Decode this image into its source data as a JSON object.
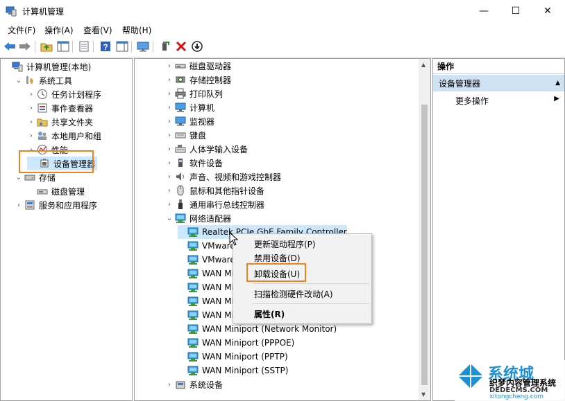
{
  "window": {
    "title": "计算机管理",
    "minimize": "—",
    "maximize": "☐",
    "close": "✕"
  },
  "menu": [
    "文件(F)",
    "操作(A)",
    "查看(V)",
    "帮助(H)"
  ],
  "toolbar": {
    "buttons": [
      "back-icon",
      "forward-icon",
      "up-folder-icon",
      "show-tree-icon",
      "properties-icon",
      "help-icon",
      "show-action-pane-icon",
      "monitor-icon",
      "enable-device-icon",
      "uninstall-icon",
      "download-driver-icon"
    ]
  },
  "left_tree": [
    {
      "label": "计算机管理(本地)",
      "indent": 0,
      "chev": "",
      "icon": "computer-mgmt-icon"
    },
    {
      "label": "系统工具",
      "indent": 1,
      "chev": "⌄",
      "icon": "tools-icon"
    },
    {
      "label": "任务计划程序",
      "indent": 2,
      "chev": "›",
      "icon": "clock-icon"
    },
    {
      "label": "事件查看器",
      "indent": 2,
      "chev": "›",
      "icon": "event-viewer-icon"
    },
    {
      "label": "共享文件夹",
      "indent": 2,
      "chev": "›",
      "icon": "shared-folder-icon"
    },
    {
      "label": "本地用户和组",
      "indent": 2,
      "chev": "›",
      "icon": "users-icon"
    },
    {
      "label": "性能",
      "indent": 2,
      "chev": "›",
      "icon": "performance-icon"
    },
    {
      "label": "设备管理器",
      "indent": 2,
      "chev": "",
      "icon": "device-manager-icon"
    },
    {
      "label": "存储",
      "indent": 1,
      "chev": "⌄",
      "icon": "storage-icon"
    },
    {
      "label": "磁盘管理",
      "indent": 2,
      "chev": "",
      "icon": "disk-icon"
    },
    {
      "label": "服务和应用程序",
      "indent": 1,
      "chev": "›",
      "icon": "services-icon"
    }
  ],
  "device_tree": [
    {
      "label": "磁盘驱动器",
      "indent": 1,
      "chev": "›",
      "icon": "disk-drive-icon"
    },
    {
      "label": "存储控制器",
      "indent": 1,
      "chev": "›",
      "icon": "storage-controller-icon"
    },
    {
      "label": "打印队列",
      "indent": 1,
      "chev": "›",
      "icon": "printer-icon"
    },
    {
      "label": "计算机",
      "indent": 1,
      "chev": "›",
      "icon": "monitor-icon"
    },
    {
      "label": "监视器",
      "indent": 1,
      "chev": "›",
      "icon": "monitor-icon"
    },
    {
      "label": "键盘",
      "indent": 1,
      "chev": "›",
      "icon": "keyboard-icon"
    },
    {
      "label": "人体学输入设备",
      "indent": 1,
      "chev": "›",
      "icon": "hid-icon"
    },
    {
      "label": "软件设备",
      "indent": 1,
      "chev": "›",
      "icon": "software-device-icon"
    },
    {
      "label": "声音、视频和游戏控制器",
      "indent": 1,
      "chev": "›",
      "icon": "speaker-icon"
    },
    {
      "label": "鼠标和其他指针设备",
      "indent": 1,
      "chev": "›",
      "icon": "mouse-icon"
    },
    {
      "label": "通用串行总线控制器",
      "indent": 1,
      "chev": "›",
      "icon": "usb-icon"
    },
    {
      "label": "网络适配器",
      "indent": 1,
      "chev": "⌄",
      "icon": "network-adapter-icon"
    },
    {
      "label": "Realtek PCIe GbE Family Controller",
      "indent": 2,
      "chev": "",
      "icon": "network-adapter-icon"
    },
    {
      "label": "VMware",
      "indent": 2,
      "chev": "",
      "icon": "network-adapter-icon"
    },
    {
      "label": "VMware",
      "indent": 2,
      "chev": "",
      "icon": "network-adapter-icon"
    },
    {
      "label": "WAN Mini",
      "indent": 2,
      "chev": "",
      "icon": "network-adapter-icon"
    },
    {
      "label": "WAN Mini",
      "indent": 2,
      "chev": "",
      "icon": "network-adapter-icon"
    },
    {
      "label": "WAN Mini",
      "indent": 2,
      "chev": "",
      "icon": "network-adapter-icon"
    },
    {
      "label": "WAN Mini",
      "indent": 2,
      "chev": "",
      "icon": "network-adapter-icon"
    },
    {
      "label": "WAN Miniport (Network Monitor)",
      "indent": 2,
      "chev": "",
      "icon": "network-adapter-icon"
    },
    {
      "label": "WAN Miniport (PPPOE)",
      "indent": 2,
      "chev": "",
      "icon": "network-adapter-icon"
    },
    {
      "label": "WAN Miniport (PPTP)",
      "indent": 2,
      "chev": "",
      "icon": "network-adapter-icon"
    },
    {
      "label": "WAN Miniport (SSTP)",
      "indent": 2,
      "chev": "",
      "icon": "network-adapter-icon"
    },
    {
      "label": "系统设备",
      "indent": 1,
      "chev": "›",
      "icon": "system-device-icon"
    }
  ],
  "context_menu": {
    "items": [
      "更新驱动程序(P)",
      "禁用设备(D)",
      "卸载设备(U)",
      "扫描检测硬件改动(A)",
      "属性(R)"
    ]
  },
  "actions": {
    "header": "操作",
    "section": "设备管理器",
    "more": "更多操作"
  },
  "watermark": {
    "brand": "系统城",
    "line1": "织梦内容管理系统",
    "line2": "DEDECMS.COM",
    "line3": "xitongcheng.com"
  }
}
